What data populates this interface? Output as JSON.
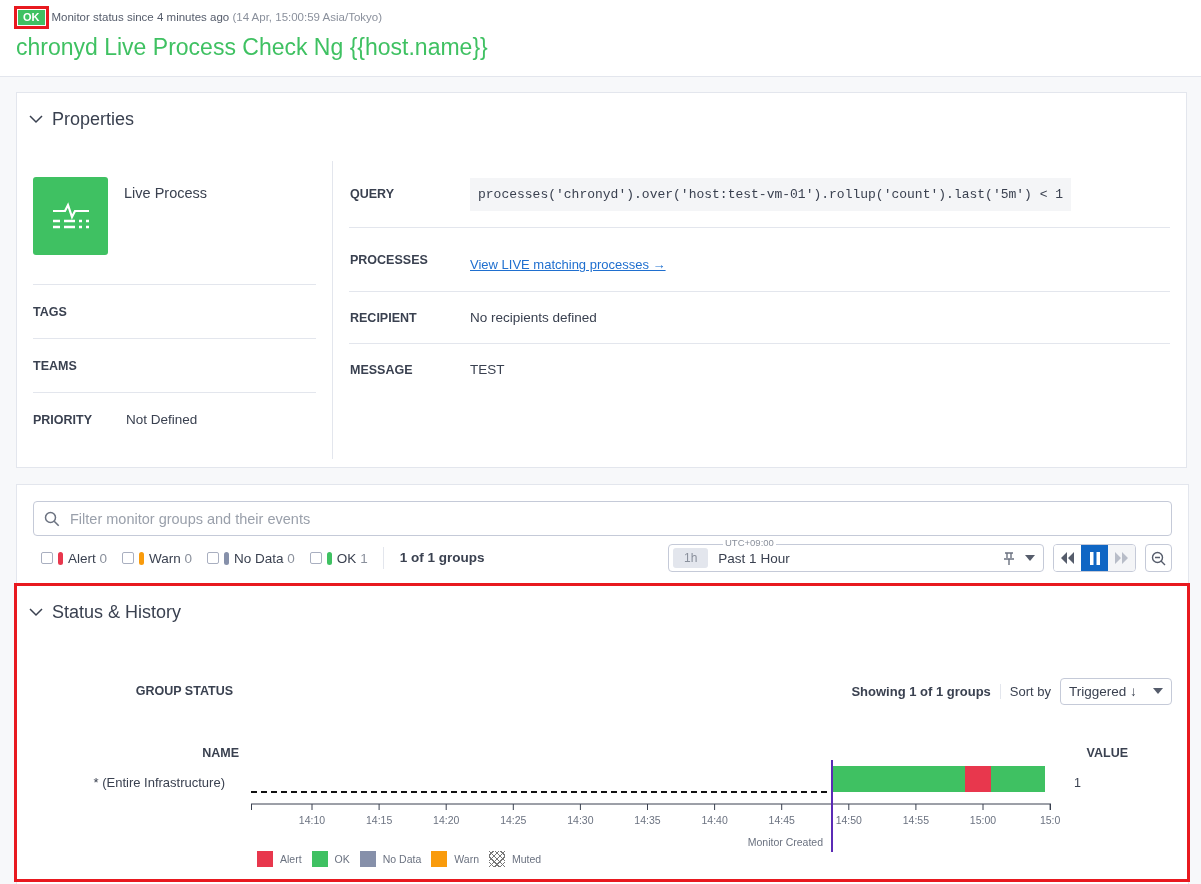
{
  "header": {
    "status_badge": "OK",
    "highlighted": true,
    "status_text": "Monitor status since 4 minutes ago",
    "timestamp": "(14 Apr, 15:00:59 Asia/Tokyo)",
    "title": "chronyd Live Process Check Ng {{host.name}}"
  },
  "properties": {
    "title": "Properties",
    "expanded": true,
    "monitor_type": "Live Process",
    "left_fields": [
      {
        "label": "TAGS"
      },
      {
        "label": "TEAMS"
      },
      {
        "label": "PRIORITY",
        "value": "Not Defined"
      }
    ],
    "right_fields": [
      {
        "label": "QUERY",
        "kind": "code",
        "value": "processes('chronyd').over('host:test-vm-01').rollup('count').last('5m') < 1"
      },
      {
        "label": "PROCESSES",
        "kind": "link",
        "value": "View LIVE matching processes →"
      },
      {
        "label": "RECIPIENT",
        "kind": "text",
        "value": "No recipients defined"
      },
      {
        "label": "MESSAGE",
        "kind": "text",
        "value": "TEST"
      }
    ]
  },
  "filter": {
    "placeholder": "Filter monitor groups and their events",
    "statuses": [
      {
        "label": "Alert",
        "count": "0",
        "color": "#e8374d",
        "checked": false
      },
      {
        "label": "Warn",
        "count": "0",
        "color": "#f99b0c",
        "checked": false
      },
      {
        "label": "No Data",
        "count": "0",
        "color": "#8690aa",
        "checked": false
      },
      {
        "label": "OK",
        "count": "1",
        "color": "#3fc162",
        "checked": false
      }
    ],
    "group_count": "1 of 1 groups"
  },
  "time_picker": {
    "zone": "UTC+09:00",
    "shortcut": "1h",
    "range": "Past 1 Hour",
    "paused": true
  },
  "history": {
    "title": "Status & History",
    "expanded": true,
    "highlighted": true,
    "group_status_label": "GROUP STATUS",
    "showing": "Showing 1 of 1 groups",
    "sort_label": "Sort by",
    "sort_value": "Triggered ↓",
    "name_header": "NAME",
    "value_header": "VALUE",
    "rows": [
      {
        "name": "* (Entire Infrastructure)",
        "value": "1"
      }
    ],
    "ticks": [
      "14:10",
      "14:15",
      "14:20",
      "14:25",
      "14:30",
      "14:35",
      "14:40",
      "14:45",
      "14:50",
      "14:55",
      "15:00",
      "15:0"
    ],
    "marker_label": "Monitor Created",
    "legend": [
      {
        "label": "Alert",
        "kind": "alert"
      },
      {
        "label": "OK",
        "kind": "ok"
      },
      {
        "label": "No Data",
        "kind": "nodata"
      },
      {
        "label": "Warn",
        "kind": "warn"
      },
      {
        "label": "Muted",
        "kind": "muted"
      }
    ]
  }
}
